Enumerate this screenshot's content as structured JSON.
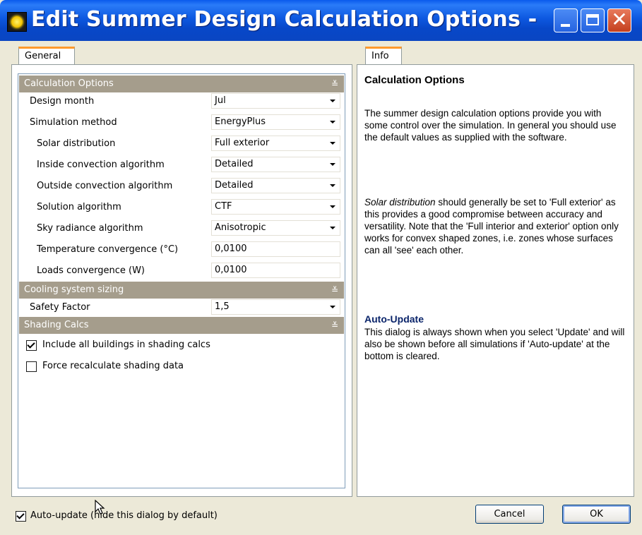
{
  "window": {
    "title": "Edit Summer Design Calculation Options -"
  },
  "tabs": {
    "general": "General",
    "info": "Info"
  },
  "sections": {
    "calculation_options": {
      "title": "Calculation Options",
      "rows": [
        {
          "label": "Design month",
          "value": "Jul",
          "type": "select"
        },
        {
          "label": "Simulation method",
          "value": "EnergyPlus",
          "type": "select"
        },
        {
          "label": "Solar distribution",
          "value": "Full exterior",
          "type": "select"
        },
        {
          "label": "Inside convection algorithm",
          "value": "Detailed",
          "type": "select"
        },
        {
          "label": "Outside convection algorithm",
          "value": "Detailed",
          "type": "select"
        },
        {
          "label": "Solution algorithm",
          "value": "CTF",
          "type": "select"
        },
        {
          "label": "Sky radiance algorithm",
          "value": "Anisotropic",
          "type": "select"
        },
        {
          "label": "Temperature convergence (°C)",
          "value": "0,0100",
          "type": "text"
        },
        {
          "label": "Loads convergence (W)",
          "value": "0,0100",
          "type": "text"
        }
      ]
    },
    "cooling_system_sizing": {
      "title": "Cooling system sizing",
      "rows": [
        {
          "label": "Safety Factor",
          "value": "1,5",
          "type": "select"
        }
      ]
    },
    "shading_calcs": {
      "title": "Shading Calcs",
      "checkboxes": [
        {
          "label": "Include all buildings in shading calcs",
          "checked": true
        },
        {
          "label": "Force recalculate shading data",
          "checked": false
        }
      ]
    }
  },
  "info": {
    "heading": "Calculation Options",
    "para1": "The summer design calculation options provide you with some control over the simulation.  In general you should use the default values as supplied with the software.",
    "para2_em": "Solar distribution",
    "para2_rest": " should generally be set to 'Full exterior' as this provides a good compromise between accuracy and versatility.  Note that the 'Full interior and exterior' option only works for convex shaped zones, i.e. zones whose surfaces can all 'see' each other.",
    "heading2": "Auto-Update",
    "para3": "This dialog is always shown when you select 'Update' and will also be shown before all simulations if 'Auto-update' at the bottom is cleared."
  },
  "footer": {
    "auto_update_label": "Auto-update (hide this dialog by default)",
    "auto_update_checked": true,
    "cancel": "Cancel",
    "ok": "OK"
  },
  "icons": {
    "app": "sun-icon",
    "section_toggle": "double-chevron-up-icon"
  }
}
